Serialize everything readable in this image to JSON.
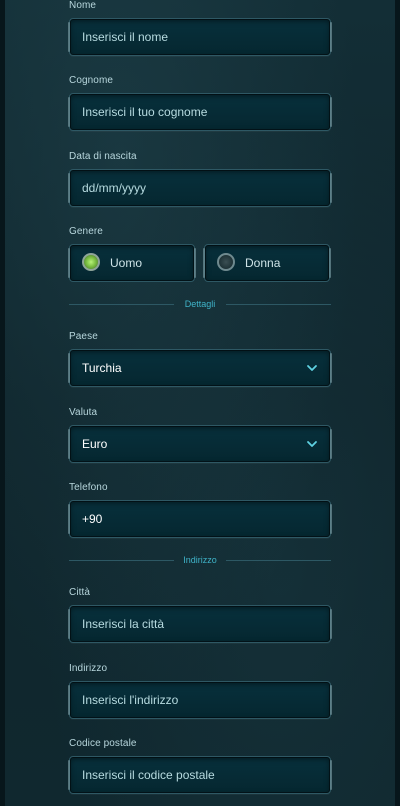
{
  "form": {
    "nome": {
      "label": "Nome",
      "placeholder": "Inserisci il nome"
    },
    "cognome": {
      "label": "Cognome",
      "placeholder": "Inserisci il tuo cognome"
    },
    "data_nascita": {
      "label": "Data di nascita",
      "placeholder": "dd/mm/yyyy"
    },
    "genere": {
      "label": "Genere",
      "options": [
        {
          "label": "Uomo",
          "selected": true
        },
        {
          "label": "Donna",
          "selected": false
        }
      ]
    },
    "section_dettagli": "Dettagli",
    "paese": {
      "label": "Paese",
      "value": "Turchia"
    },
    "valuta": {
      "label": "Valuta",
      "value": "Euro"
    },
    "telefono": {
      "label": "Telefono",
      "value": "+90"
    },
    "section_indirizzo": "Indirizzo",
    "citta": {
      "label": "Città",
      "placeholder": "Inserisci la città"
    },
    "indirizzo": {
      "label": "Indirizzo",
      "placeholder": "Inserisci l'indirizzo"
    },
    "codice_postale": {
      "label": "Codice postale",
      "placeholder": "Inserisci il codice postale"
    }
  },
  "icons": {
    "select_chevron": "chevron-down-icon",
    "radio": "radio-button-icon"
  },
  "colors": {
    "background": "#132e36",
    "field_bg": "#07303c",
    "field_border": "#2e5864",
    "label": "#b7d6dc",
    "section_text": "#3fb3c8",
    "radio_selected": "#7cc043"
  }
}
